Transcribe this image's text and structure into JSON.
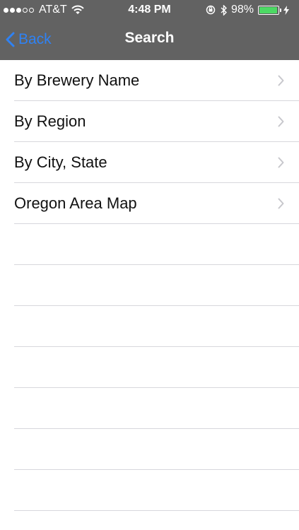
{
  "status_bar": {
    "carrier": "AT&T",
    "signal_dots": [
      true,
      true,
      true,
      false,
      false
    ],
    "time": "4:48 PM",
    "battery_percent": "98%",
    "battery_level": 0.98,
    "battery_color": "#4cd964"
  },
  "nav": {
    "back_label": "Back",
    "title": "Search",
    "bar_color": "#626262",
    "accent": "#2f82f4"
  },
  "menu": {
    "items": [
      {
        "label": "By Brewery Name"
      },
      {
        "label": "By Region"
      },
      {
        "label": "By City, State"
      },
      {
        "label": "Oregon Area Map"
      }
    ],
    "empty_rows": 7
  }
}
